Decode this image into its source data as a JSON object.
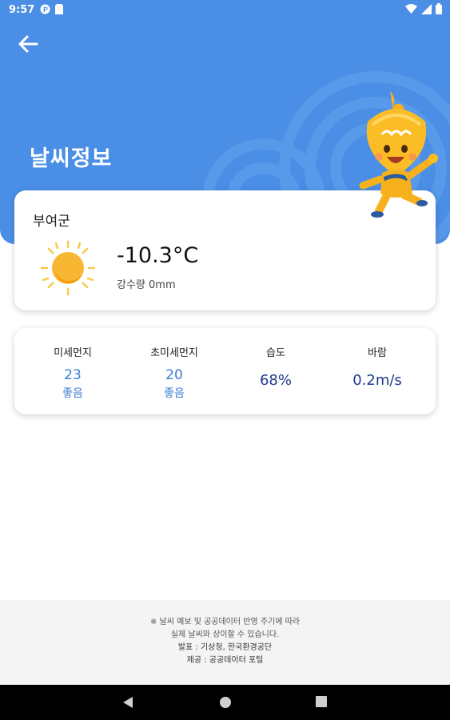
{
  "status_bar": {
    "time": "9:57"
  },
  "header": {
    "title": "날씨정보"
  },
  "weather": {
    "region": "부여군",
    "temperature": "-10.3°C",
    "precipitation": "강수량 0mm",
    "icon": "sun-icon"
  },
  "stats": [
    {
      "label": "미세먼지",
      "value": "23",
      "grade": "좋음"
    },
    {
      "label": "초미세먼지",
      "value": "20",
      "grade": "좋음"
    },
    {
      "label": "습도",
      "value": "68%"
    },
    {
      "label": "바람",
      "value": "0.2m/s"
    }
  ],
  "footer": {
    "line1": "※ 날씨 예보 및 공공데이터 반영 주기에 따라",
    "line2": "실제 날씨와 상이할 수 있습니다.",
    "line3": "발표 : 기상청, 한국환경공단",
    "line4": "제공 : 공공데이터 포털"
  },
  "colors": {
    "header_bg": "#4a8ee6",
    "accent": "#3a7bd5",
    "dark_value": "#1e3a8a"
  }
}
